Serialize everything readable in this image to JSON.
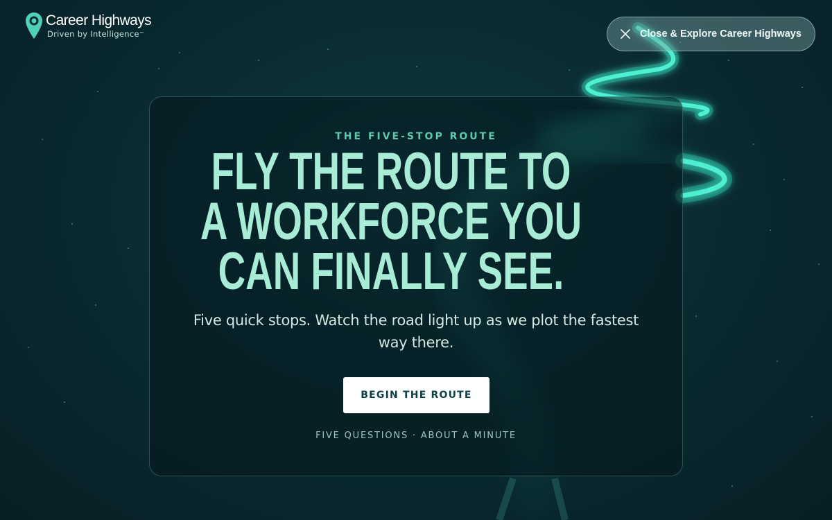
{
  "brand": {
    "name": "Career Highways",
    "tagline": "Driven by Intelligence",
    "trademark": "™",
    "pin_icon": "map-pin-icon",
    "accent_color": "#4fd1b4"
  },
  "header": {
    "close_button_label": "Close & Explore Career Highways",
    "close_icon": "close-icon"
  },
  "hero": {
    "eyebrow": "THE FIVE-STOP ROUTE",
    "headline_lines": [
      "FLY THE ROUTE TO",
      "A WORKFORCE YOU",
      "CAN FINALLY SEE."
    ],
    "subtitle": "Five quick stops. Watch the road light up as we plot the fastest way there.",
    "cta_label": "BEGIN THE ROUTE",
    "meta": "FIVE QUESTIONS · ABOUT A MINUTE"
  },
  "colors": {
    "background": "#0a2c32",
    "headline": "#a8ecd6",
    "eyebrow": "#5fc9ae",
    "road_glow": "#3ee8c8",
    "cta_text": "#0b3f48"
  }
}
